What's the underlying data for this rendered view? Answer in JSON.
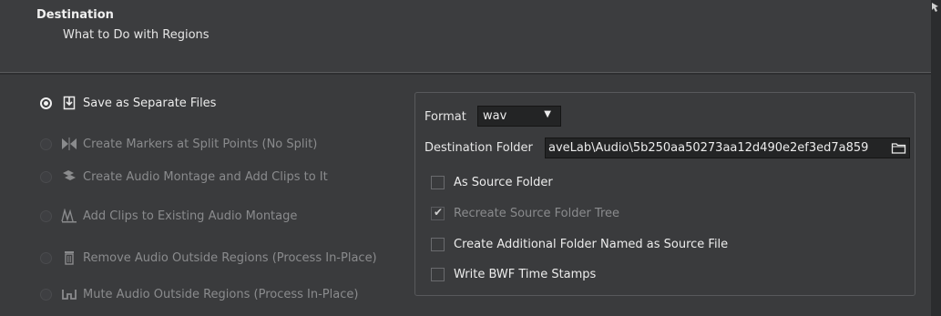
{
  "header": {
    "title": "Destination",
    "subtitle": "What to Do with Regions"
  },
  "options": [
    {
      "label": "Save as Separate Files",
      "selected": true,
      "enabled": true,
      "icon": "save-files-icon"
    },
    {
      "label": "Create Markers at Split Points (No Split)",
      "selected": false,
      "enabled": false,
      "icon": "split-markers-icon"
    },
    {
      "label": "Create Audio Montage and Add Clips to It",
      "selected": false,
      "enabled": false,
      "icon": "new-montage-icon"
    },
    {
      "label": "Add Clips to Existing Audio Montage",
      "selected": false,
      "enabled": false,
      "icon": "existing-montage-icon"
    },
    {
      "label": "Remove Audio Outside Regions (Process In-Place)",
      "selected": false,
      "enabled": false,
      "icon": "trash-icon"
    },
    {
      "label": "Mute Audio Outside Regions (Process In-Place)",
      "selected": false,
      "enabled": false,
      "icon": "mute-icon"
    }
  ],
  "format": {
    "label": "Format",
    "value": "wav"
  },
  "destination": {
    "label": "Destination Folder",
    "path": "aveLab\\Audio\\5b250aa50273aa12d490e2ef3ed7a859"
  },
  "checkboxes": [
    {
      "label": "As Source Folder",
      "checked": false,
      "enabled": true
    },
    {
      "label": "Recreate Source Folder Tree",
      "checked": true,
      "enabled": false
    },
    {
      "label": "Create Additional Folder Named as Source File",
      "checked": false,
      "enabled": true
    },
    {
      "label": "Write BWF Time Stamps",
      "checked": false,
      "enabled": true
    }
  ]
}
